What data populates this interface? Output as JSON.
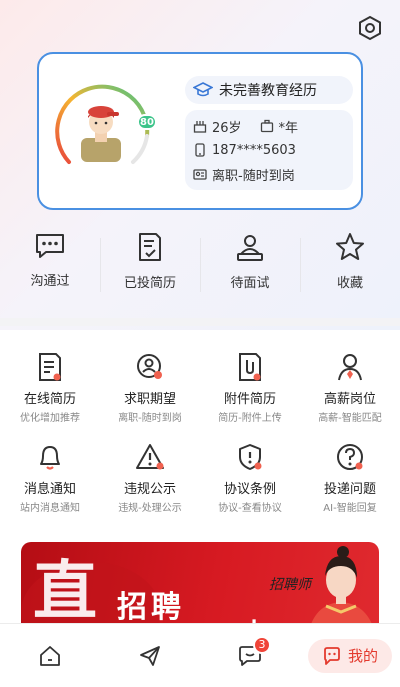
{
  "profile": {
    "score": "80",
    "education_status": "未完善教育经历",
    "age": "26岁",
    "experience": "*年",
    "phone": "187****5603",
    "job_status": "离职-随时到岗"
  },
  "quick_actions": [
    {
      "label": "沟通过",
      "icon": "chat-bubble-icon"
    },
    {
      "label": "已投简历",
      "icon": "resume-check-icon"
    },
    {
      "label": "待面试",
      "icon": "interview-icon"
    },
    {
      "label": "收藏",
      "icon": "star-icon"
    }
  ],
  "services": [
    {
      "label": "在线简历",
      "sub": "优化增加推荐",
      "icon": "online-resume-icon"
    },
    {
      "label": "求职期望",
      "sub": "离职-随时到岗",
      "icon": "job-expectation-icon"
    },
    {
      "label": "附件简历",
      "sub": "简历-附件上传",
      "icon": "attachment-resume-icon"
    },
    {
      "label": "高薪岗位",
      "sub": "高薪-智能匹配",
      "icon": "high-salary-icon"
    },
    {
      "label": "消息通知",
      "sub": "站内消息通知",
      "icon": "bell-icon"
    },
    {
      "label": "违规公示",
      "sub": "违规-处理公示",
      "icon": "warning-icon"
    },
    {
      "label": "协议条例",
      "sub": "协议-查看协议",
      "icon": "shield-icon"
    },
    {
      "label": "投递问题",
      "sub": "AI-智能回复",
      "icon": "question-icon"
    }
  ],
  "banner": {
    "big_char": "直",
    "title": "招聘",
    "title2": "上",
    "signature": "招聘师"
  },
  "tabbar": {
    "message_badge": "3",
    "me_label": "我的"
  },
  "colors": {
    "accent_blue": "#4a90e2",
    "accent_red": "#e33a2e",
    "score_green": "#3cc48a"
  }
}
